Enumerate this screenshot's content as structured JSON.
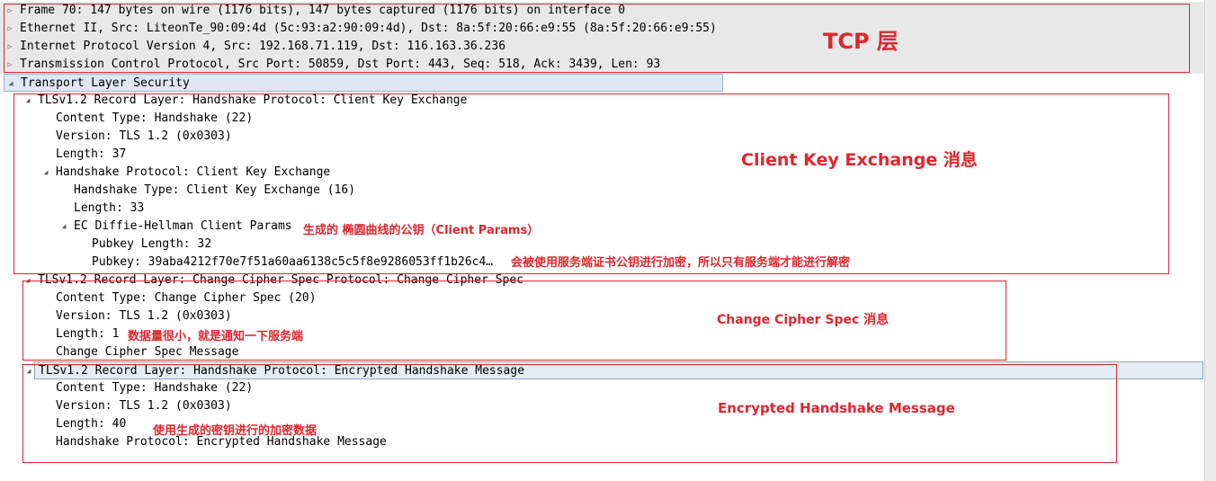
{
  "tree": {
    "frame": "Frame 70: 147 bytes on wire (1176 bits), 147 bytes captured (1176 bits) on interface 0",
    "ethernet": "Ethernet II, Src: LiteonTe_90:09:4d (5c:93:a2:90:09:4d), Dst: 8a:5f:20:66:e9:55 (8a:5f:20:66:e9:55)",
    "ip": "Internet Protocol Version 4, Src: 192.168.71.119, Dst: 116.163.36.236",
    "tcp": "Transmission Control Protocol, Src Port: 50859, Dst Port: 443, Seq: 518, Ack: 3439, Len: 93",
    "tls": "Transport Layer Security",
    "rec1": {
      "header": "TLSv1.2 Record Layer: Handshake Protocol: Client Key Exchange",
      "content_type": "Content Type: Handshake (22)",
      "version": "Version: TLS 1.2 (0x0303)",
      "length": "Length: 37",
      "handshake": "Handshake Protocol: Client Key Exchange",
      "hs_type": "Handshake Type: Client Key Exchange (16)",
      "hs_length": "Length: 33",
      "ec": "EC Diffie-Hellman Client Params",
      "pubkey_len": "Pubkey Length: 32",
      "pubkey": "Pubkey: 39aba4212f70e7f51a60aa6138c5c5f8e9286053ff1b26c4…"
    },
    "rec2": {
      "header": "TLSv1.2 Record Layer: Change Cipher Spec Protocol: Change Cipher Spec",
      "content_type": "Content Type: Change Cipher Spec (20)",
      "version": "Version: TLS 1.2 (0x0303)",
      "length": "Length: 1",
      "message": "Change Cipher Spec Message"
    },
    "rec3": {
      "header": "TLSv1.2 Record Layer: Handshake Protocol: Encrypted Handshake Message",
      "content_type": "Content Type: Handshake (22)",
      "version": "Version: TLS 1.2 (0x0303)",
      "length": "Length: 40",
      "handshake": "Handshake Protocol: Encrypted Handshake Message"
    }
  },
  "annotations": {
    "tcp": "TCP 层",
    "cke": "Client Key Exchange 消息",
    "ec": "生成的 椭圆曲线的公钥（Client Params）",
    "pubkey": "会被使用服务端证书公钥进行加密，所以只有服务端才能进行解密",
    "ccs": "Change Cipher Spec 消息",
    "ccs_len": "数据量很小，就是通知一下服务端",
    "ehm": "Encrypted Handshake Message",
    "ehm_len": "使用生成的密钥进行的加密数据"
  },
  "colors": {
    "annotation": "#e0262d"
  }
}
